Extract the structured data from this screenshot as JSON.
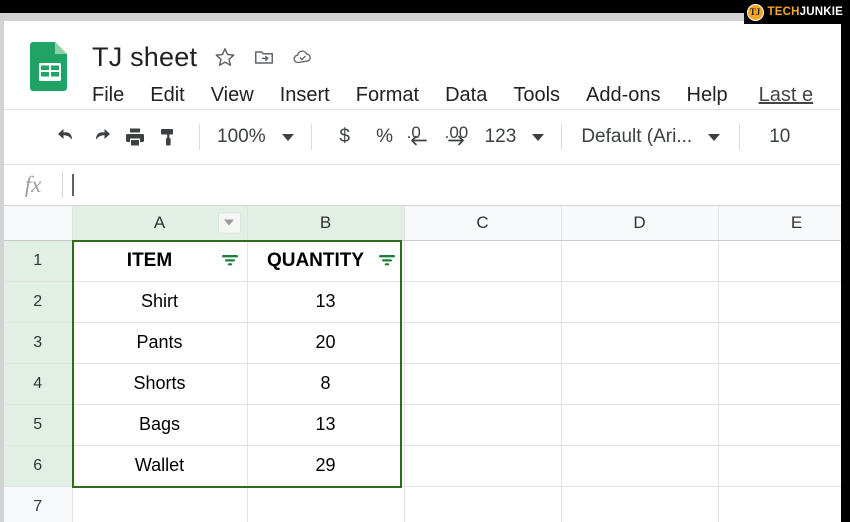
{
  "watermark": {
    "badge": "TJ",
    "tech": "TECH",
    "junkie": "JUNKIE",
    "tech_color": "#f5a623",
    "junkie_color": "#ffffff"
  },
  "header": {
    "doc_title": "TJ sheet",
    "icons": [
      "star-icon",
      "move-to-folder-icon",
      "cloud-saved-icon"
    ],
    "menu": [
      {
        "label": "File"
      },
      {
        "label": "Edit"
      },
      {
        "label": "View"
      },
      {
        "label": "Insert"
      },
      {
        "label": "Format"
      },
      {
        "label": "Data"
      },
      {
        "label": "Tools"
      },
      {
        "label": "Add-ons"
      },
      {
        "label": "Help"
      }
    ],
    "last_edit": "Last e"
  },
  "toolbar": {
    "undo": "undo-icon",
    "redo": "redo-icon",
    "print": "print-icon",
    "paint_format": "paint-format-icon",
    "zoom_value": "100%",
    "currency": "$",
    "percent": "%",
    "decrease_decimal": ".0",
    "increase_decimal": ".00",
    "number_format": "123",
    "font_name": "Default (Ari...",
    "font_size": "10"
  },
  "formula_bar": {
    "fx_label": "fx",
    "value": ""
  },
  "grid": {
    "columns": [
      {
        "label": "A",
        "selected": true,
        "has_dropdown": true,
        "width": 175
      },
      {
        "label": "B",
        "selected": true,
        "has_dropdown": false,
        "width": 157
      },
      {
        "label": "C",
        "selected": false,
        "has_dropdown": false,
        "width": 157
      },
      {
        "label": "D",
        "selected": false,
        "has_dropdown": false,
        "width": 157
      },
      {
        "label": "E",
        "selected": false,
        "has_dropdown": false,
        "width": 157
      }
    ],
    "header_row": {
      "number": "1",
      "selected": true,
      "cells": [
        {
          "text": "ITEM",
          "filter": true
        },
        {
          "text": "QUANTITY",
          "filter": true
        },
        {
          "text": "",
          "filter": false
        },
        {
          "text": "",
          "filter": false
        },
        {
          "text": "",
          "filter": false
        }
      ]
    },
    "rows": [
      {
        "number": "2",
        "selected": true,
        "cells": [
          "Shirt",
          "13",
          "",
          "",
          ""
        ]
      },
      {
        "number": "3",
        "selected": true,
        "cells": [
          "Pants",
          "20",
          "",
          "",
          ""
        ]
      },
      {
        "number": "4",
        "selected": true,
        "cells": [
          "Shorts",
          "8",
          "",
          "",
          ""
        ]
      },
      {
        "number": "5",
        "selected": true,
        "cells": [
          "Bags",
          "13",
          "",
          "",
          ""
        ]
      },
      {
        "number": "6",
        "selected": true,
        "cells": [
          "Wallet",
          "29",
          "",
          "",
          ""
        ]
      },
      {
        "number": "7",
        "selected": false,
        "cells": [
          "",
          "",
          "",
          "",
          ""
        ]
      }
    ],
    "selection_color": "#33691e",
    "selected_tint": "#e2efe5"
  }
}
